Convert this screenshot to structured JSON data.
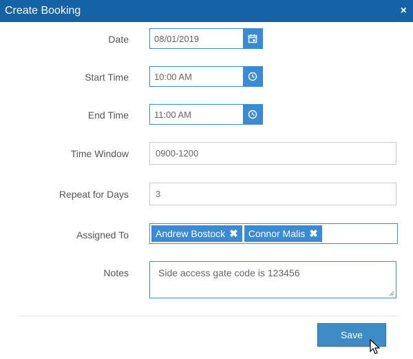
{
  "dialog": {
    "title": "Create Booking",
    "close_glyph": "×"
  },
  "form": {
    "date": {
      "label": "Date",
      "value": "08/01/2019",
      "icon": "calendar-icon"
    },
    "start_time": {
      "label": "Start Time",
      "value": "10:00 AM",
      "icon": "clock-icon"
    },
    "end_time": {
      "label": "End Time",
      "value": "11:00 AM",
      "icon": "clock-icon"
    },
    "time_window": {
      "label": "Time Window",
      "value": "0900-1200"
    },
    "repeat_days": {
      "label": "Repeat for Days",
      "value": "3"
    },
    "assigned_to": {
      "label": "Assigned To",
      "tags": [
        {
          "name": "Andrew Bostock",
          "remove": "✖"
        },
        {
          "name": "Connor Malis",
          "remove": "✖"
        }
      ]
    },
    "notes": {
      "label": "Notes",
      "value": "Side access gate code is 123456"
    }
  },
  "actions": {
    "save_label": "Save"
  },
  "colors": {
    "header": "#1662a7",
    "accent": "#3a8bd3",
    "save": "#3d8cc6"
  }
}
